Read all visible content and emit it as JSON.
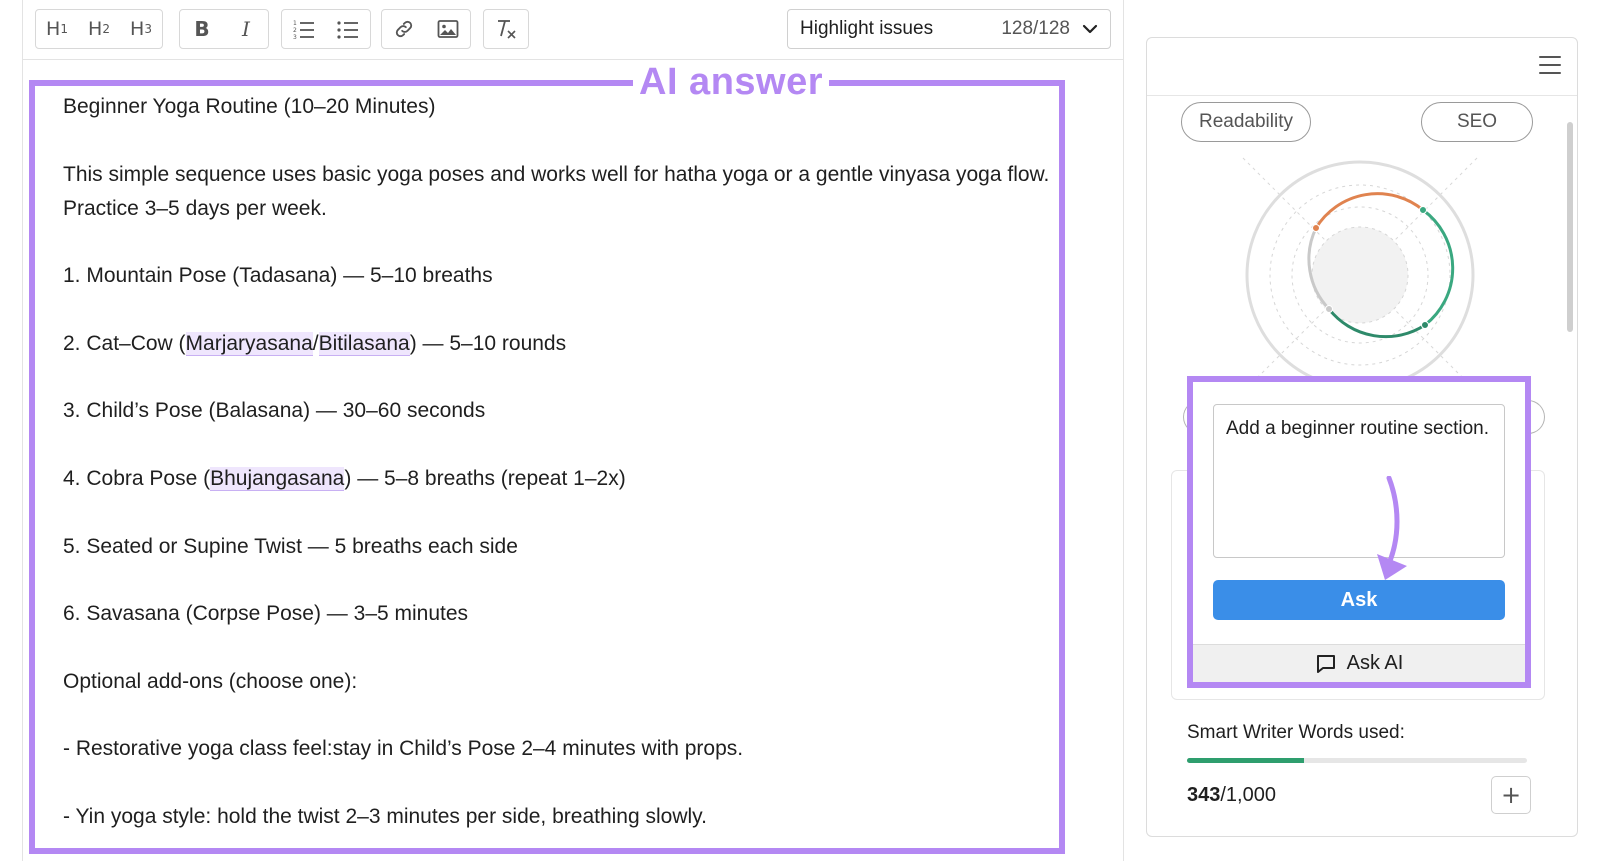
{
  "toolbar": {
    "headings": [
      "H",
      "H",
      "H"
    ],
    "heading_levels": [
      "1",
      "2",
      "3"
    ],
    "bold_label": "B",
    "italic_label": "I",
    "icons": [
      "bold-icon",
      "italic-icon",
      "ordered-list-icon",
      "bullet-list-icon",
      "link-icon",
      "image-icon",
      "clear-format-icon"
    ],
    "highlight": {
      "label": "Highlight issues",
      "count": "128/128"
    }
  },
  "editor": {
    "overlay_title": "AI answer",
    "accent_color": "#b488f3",
    "paragraphs": {
      "p0": "Beginner Yoga Routine (10–20 Minutes)",
      "p1": "This simple sequence uses basic yoga poses and works well for hatha yoga or a gentle vinyasa yoga flow. Practice 3–5 days per week.",
      "p2": "1. Mountain Pose (Tadasana) — 5–10 breaths",
      "p3": {
        "before": "2. Cat–Cow (",
        "term1": "Marjaryasana",
        "slash": "/",
        "term2": "Bitilasana",
        "after": ") — 5–10 rounds"
      },
      "p4": "3. Child’s Pose (Balasana) — 30–60 seconds",
      "p5": {
        "before": "4. Cobra Pose (",
        "term1": "Bhujangasana",
        "after": ") — 5–8 breaths (repeat 1–2x)"
      },
      "p6": "5. Seated or Supine Twist — 5 breaths each side",
      "p7": "6. Savasana (Corpse Pose) — 3–5 minutes",
      "p8": "Optional add-ons (choose one):",
      "p9": "- Restorative yoga class feel:stay in Child’s Pose 2–4 minutes with props.",
      "p10": "- Yin yoga style: hold the twist 2–3 minutes per side, breathing slowly."
    }
  },
  "panel": {
    "tabs": {
      "readability": "Readability",
      "seo": "SEO"
    },
    "ask": {
      "input_value": "Add a beginner routine section.",
      "button_label": "Ask",
      "bar_label": "Ask AI",
      "button_color": "#3a8ee8"
    },
    "words": {
      "label": "Smart Writer Words used:",
      "used": "343",
      "total": "/1,000",
      "used_fraction": 0.343,
      "fill_color": "#2e9e6e"
    },
    "add_label": "+"
  }
}
